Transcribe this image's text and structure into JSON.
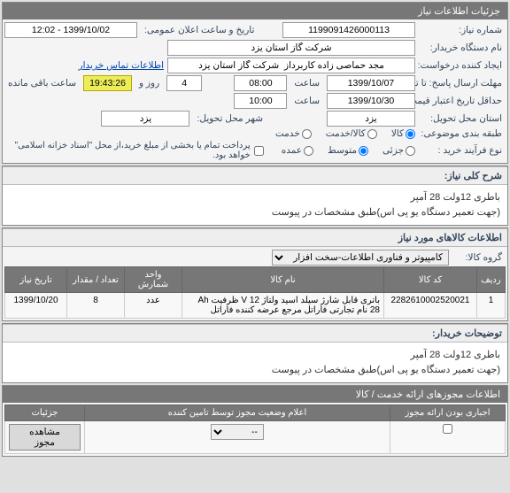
{
  "panel1": {
    "title": "جزئیات اطلاعات نیاز",
    "labels": {
      "need_no": "شماره نیاز:",
      "pub_datetime": "تاریخ و ساعت اعلان عمومی:",
      "buyer_org": "نام دستگاه خریدار:",
      "requester": "ایجاد کننده درخواست:",
      "contact_info": "اطلاعات تماس خریدار",
      "deadline_date": "مهلت ارسال پاسخ: تا تاریخ:",
      "time": "ساعت",
      "day_and": "روز و",
      "remaining": "ساعت باقی مانده",
      "price_valid_until": "حداقل تاریخ اعتبار قیمت: تا تاریخ:",
      "delivery_province": "استان محل تحویل:",
      "delivery_city": "شهر محل تحویل:",
      "budget_type": "طبقه بندی موضوعی:",
      "goods": "کالا",
      "goods_service": "کالا/خدمت",
      "service": "خدمت",
      "buy_process": "نوع فرآیند خرید :",
      "small": "جزئی",
      "medium": "متوسط",
      "large": "عمده",
      "partial_note": "پرداخت تمام یا بخشی از مبلغ خرید،از محل \"اسناد خزانه اسلامی\" خواهد بود."
    },
    "values": {
      "need_no": "1199091426000113",
      "pub_datetime": "1399/10/02 - 12:02",
      "buyer_org": "شرکت گاز استان یزد",
      "requester": "مجد حماصی زاده کاربرداز  شرکت گاز استان یزد",
      "deadline_date": "1399/10/07",
      "deadline_time": "08:00",
      "days_left": "4",
      "countdown": "19:43:26",
      "price_valid_date": "1399/10/30",
      "price_valid_time": "10:00",
      "province": "یزد",
      "city": "یزد"
    }
  },
  "sec_desc": {
    "title": "شرح کلی نیاز:",
    "body1": "باطری 12ولت 28 آمپر",
    "body2": "(جهت تعمیر دستگاه یو پی اس)طبق مشخصات در پیوست"
  },
  "sec_goods": {
    "title": "اطلاعات کالاهای مورد نیاز",
    "group_label": "گروه کالا:",
    "group_value": "کامپیوتر و فناوری اطلاعات-سخت افزار"
  },
  "table": {
    "headers": {
      "row": "ردیف",
      "code": "کد کالا",
      "name": "نام کالا",
      "unit": "واحد شمارش",
      "qty": "تعداد / مقدار",
      "date": "تاریخ نیاز"
    },
    "rows": [
      {
        "row": "1",
        "code": "2282610002520021",
        "name": "باتری قابل شارژ سیلد اسید ولتاژ V 12 ظرفیت Ah 28 نام تجارتی فاراتل مرجع عرضه کننده فاراتل",
        "unit": "عدد",
        "qty": "8",
        "date": "1399/10/20"
      }
    ]
  },
  "sec_buyer_notes": {
    "title": "توضیحات خریدار:",
    "body1": "باطری 12ولت 28 آمپر",
    "body2": "(جهت تعمیر دستگاه یو پی اس)طبق مشخصات در پیوست"
  },
  "panel2": {
    "title": "اطلاعات مجوزهای ارائه خدمت / کالا",
    "col_mandatory": "اجباری بودن ارائه مجوز",
    "col_status_announce": "اعلام وضعیت مجوز توسط تامین کننده",
    "col_details": "جزئیات",
    "btn_view": "مشاهده مجوز"
  }
}
